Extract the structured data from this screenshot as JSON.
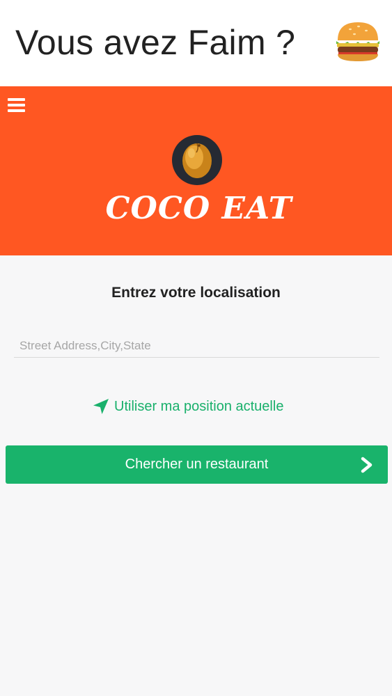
{
  "promo": {
    "headline": "Vous avez Faim ?",
    "emoji": "burger-icon"
  },
  "app": {
    "menu_icon": "hamburger-menu-icon",
    "logo_icon": "coconut-logo-icon",
    "brand_name": "COCO EAT",
    "location_heading": "Entrez votre localisation",
    "address_input": {
      "value": "",
      "placeholder": "Street Address,City,State"
    },
    "use_location": {
      "icon": "navigation-arrow-icon",
      "label": "Utiliser ma position actuelle"
    },
    "search_button": {
      "label": "Chercher un restaurant",
      "icon": "chevron-right-icon"
    }
  },
  "colors": {
    "hero_background": "#ff5722",
    "accent_green": "#19b36b",
    "screen_background": "#f7f7f8"
  }
}
